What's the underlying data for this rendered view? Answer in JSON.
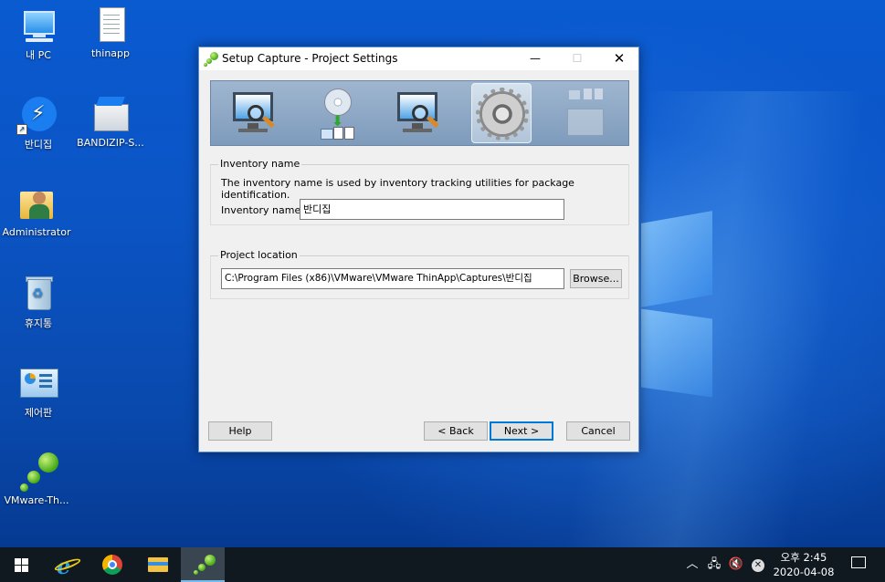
{
  "desktop": {
    "icons": [
      {
        "label": "내 PC"
      },
      {
        "label": "thinapp"
      },
      {
        "label": "반디집"
      },
      {
        "label": "BANDIZIP-S..."
      },
      {
        "label": "Administrator"
      },
      {
        "label": "휴지통"
      },
      {
        "label": "제어판"
      },
      {
        "label": "VMware-Th..."
      }
    ]
  },
  "dialog": {
    "title": "Setup Capture - Project Settings",
    "steps": [
      {
        "icon": "monitor-magnifier-icon",
        "state": "done"
      },
      {
        "icon": "disc-install-icon",
        "state": "done"
      },
      {
        "icon": "monitor-magnifier-icon",
        "state": "done"
      },
      {
        "icon": "gear-icon",
        "state": "active"
      },
      {
        "icon": "package-icon",
        "state": "pending"
      }
    ],
    "inventory": {
      "legend": "Inventory name",
      "description": "The inventory name is used by inventory tracking utilities for package identification.",
      "field_label": "Inventory name:",
      "value": "반디집"
    },
    "location": {
      "legend": "Project location",
      "value": "C:\\Program Files (x86)\\VMware\\VMware ThinApp\\Captures\\반디집",
      "browse_label": "Browse..."
    },
    "buttons": {
      "help": "Help",
      "back": "< Back",
      "next": "Next >",
      "cancel": "Cancel"
    }
  },
  "taskbar": {
    "clock_time": "오후 2:45",
    "clock_date": "2020-04-08",
    "accent": "#76b9ed"
  }
}
